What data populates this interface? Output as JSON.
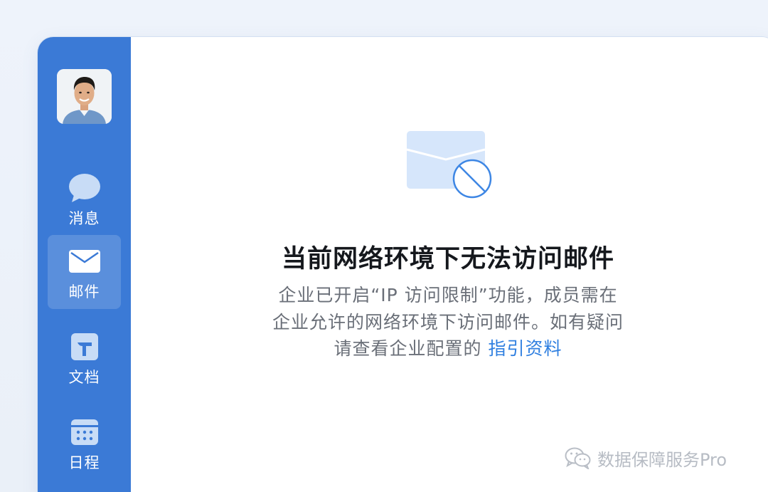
{
  "sidebar": {
    "items": [
      {
        "label": "消息",
        "icon": "message-bubble-icon"
      },
      {
        "label": "邮件",
        "icon": "mail-icon",
        "active": true
      },
      {
        "label": "文档",
        "icon": "document-icon"
      },
      {
        "label": "日程",
        "icon": "calendar-icon"
      }
    ]
  },
  "main": {
    "illustration_icon": "mail-blocked-icon",
    "title": "当前网络环境下无法访问邮件",
    "desc_line1": "企业已开启“IP 访问限制”功能，成员需在",
    "desc_line2": "企业允许的网络环境下访问邮件。如有疑问",
    "desc_line3_prefix": "请查看企业配置的",
    "desc_line3_link": "指引资料"
  },
  "watermark": {
    "text": "数据保障服务Pro",
    "icon": "wechat-icon"
  },
  "colors": {
    "sidebar": "#3b7ad6",
    "link": "#2f7fe0",
    "title": "#15181d",
    "body_text": "#6a6f78"
  }
}
